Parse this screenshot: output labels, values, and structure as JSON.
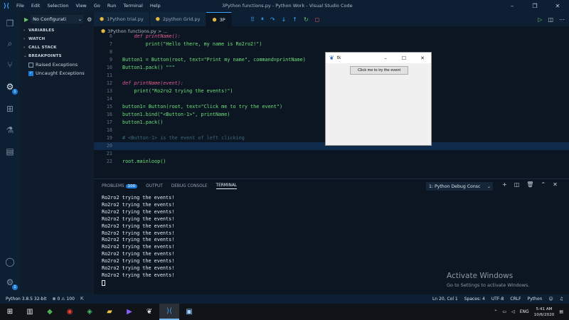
{
  "titlebar": {
    "menu": [
      "File",
      "Edit",
      "Selection",
      "View",
      "Go",
      "Run",
      "Terminal",
      "Help"
    ],
    "window_title": "3Python functions.py - Python Work - Visual Studio Code"
  },
  "sidebar": {
    "run_config": "No Configurati",
    "sections": [
      "VARIABLES",
      "WATCH",
      "CALL STACK",
      "BREAKPOINTS"
    ],
    "breakpoints": [
      {
        "label": "Raised Exceptions",
        "checked": false
      },
      {
        "label": "Uncaught Exceptions",
        "checked": true
      }
    ]
  },
  "tabs": [
    {
      "label": "1Python trial.py"
    },
    {
      "label": "2python Grid.py"
    },
    {
      "label": "3P"
    }
  ],
  "breadcrumb": "3Python functions.py > ...",
  "editor": {
    "lines": [
      {
        "n": "6",
        "text": "    def printName():",
        "cls": "kw"
      },
      {
        "n": "7",
        "text": "        print(\"Hello there, my name is Ro2ro2!\")",
        "cls": "string"
      },
      {
        "n": "8",
        "text": "",
        "cls": ""
      },
      {
        "n": "9",
        "text": "Button1 = Button(root, text=\"Print my name\", command=printName)",
        "cls": "string"
      },
      {
        "n": "10",
        "text": "Button1.pack() \"\"\"",
        "cls": "string"
      },
      {
        "n": "11",
        "text": "",
        "cls": ""
      },
      {
        "n": "12",
        "text": "def printName(event):",
        "cls": "kw"
      },
      {
        "n": "13",
        "text": "    print(\"Ro2ro2 trying the events!\")",
        "cls": "string"
      },
      {
        "n": "14",
        "text": "",
        "cls": ""
      },
      {
        "n": "15",
        "text": "button1= Button(root, text=\"Click me to try the event\")",
        "cls": "string"
      },
      {
        "n": "16",
        "text": "button1.bind(\"<Button-1>\", printName)",
        "cls": "string"
      },
      {
        "n": "17",
        "text": "button1.pack()",
        "cls": "string"
      },
      {
        "n": "18",
        "text": "",
        "cls": ""
      },
      {
        "n": "19",
        "text": "# <Button-1> is the event of left clicking",
        "cls": "comment"
      },
      {
        "n": "20",
        "text": "",
        "cls": ""
      },
      {
        "n": "21",
        "text": "",
        "cls": ""
      },
      {
        "n": "22",
        "text": "root.mainloop()",
        "cls": "string"
      }
    ]
  },
  "tk_window": {
    "title": "tk",
    "button_label": "Click me to try the event"
  },
  "panel": {
    "tabs": [
      "PROBLEMS",
      "OUTPUT",
      "DEBUG CONSOLE",
      "TERMINAL"
    ],
    "problems_count": "100",
    "terminal_select": "1: Python Debug Consc",
    "terminal_lines": [
      "Ro2ro2 trying the events!",
      "Ro2ro2 trying the events!",
      "Ro2ro2 trying the events!",
      "Ro2ro2 trying the events!",
      "Ro2ro2 trying the events!",
      "Ro2ro2 trying the events!",
      "Ro2ro2 trying the events!",
      "Ro2ro2 trying the events!",
      "Ro2ro2 trying the events!",
      "Ro2ro2 trying the events!",
      "Ro2ro2 trying the events!",
      "Ro2ro2 trying the events!"
    ],
    "activate_title": "Activate Windows",
    "activate_sub": "Go to Settings to activate Windows."
  },
  "statusbar": {
    "python": "Python 3.8.5 32-bit",
    "problems": "⊗ 0 ⚠ 100",
    "position": "Ln 20, Col 1",
    "spaces": "Spaces: 4",
    "encoding": "UTF-8",
    "eol": "CRLF",
    "language": "Python"
  },
  "taskbar": {
    "lang": "ENG",
    "time": "5:41 AM",
    "date": "10/6/2020"
  }
}
